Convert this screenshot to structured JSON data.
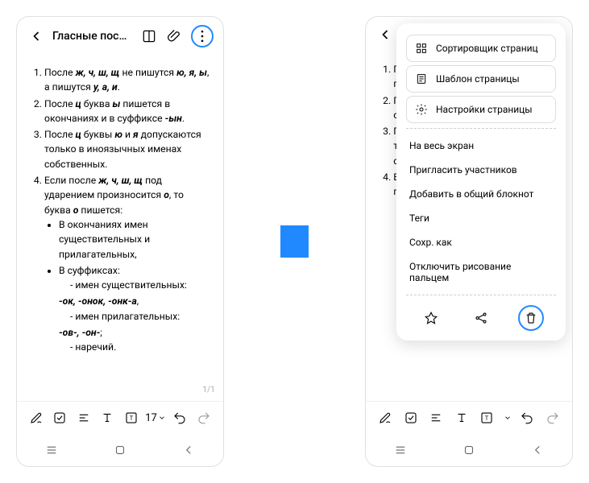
{
  "header": {
    "title": "Гласные после шип..."
  },
  "menu": {
    "sorter": "Сортировщик страниц",
    "template": "Шаблон страницы",
    "settings": "Настройки страницы",
    "fullscreen": "На весь экран",
    "invite": "Пригласить участников",
    "addShared": "Добавить в общий блокнот",
    "tags": "Теги",
    "saveAs": "Сохр. как",
    "disableFinger": "Отключить рисование пальцем"
  },
  "note": {
    "li1a": "После ",
    "li1b": "ж, ч, ш, щ",
    "li1c": " не пишутся ",
    "li1d": "ю, я, ы",
    "li1e": ", а пишутся ",
    "li1f": "у, а, и",
    "li1g": ".",
    "li2a": "После ",
    "li2b": "ц",
    "li2c": " буква ",
    "li2d": "ы",
    "li2e": " пишется в окончаниях и в суффиксе ",
    "li2f": "-ын",
    "li2g": ".",
    "li3a": "После ",
    "li3b": "ц",
    "li3c": " буквы ",
    "li3d": "ю",
    "li3e": " и ",
    "li3f": "я",
    "li3g": " допускаются только в иноязычных именах собственных.",
    "li4a": "Если после ",
    "li4b": "ж, ч, ш, щ",
    "li4c": " под ударением произносится ",
    "li4d": "о",
    "li4e": ", то буква ",
    "li4f": "о",
    "li4g": " пишется:",
    "b1a": "В окончаниях имен существительных и прилагательных,",
    "b2a": "В суффиксах:",
    "d1": "имен существительных:",
    "d1s": "-ок, -онок, -онк-а",
    "d1t": ",",
    "d2": "имен прилагательных:",
    "d2s": "-ов-, -он-",
    "d2t": ";",
    "d3": "наречий."
  },
  "toolbar": {
    "fontSize": "17"
  },
  "pageIndicator": "1/1"
}
